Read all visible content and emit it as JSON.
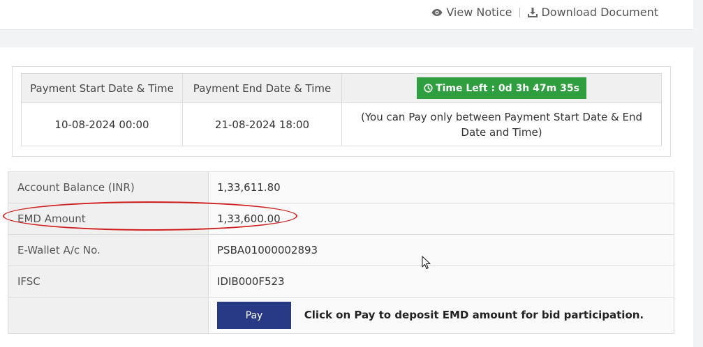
{
  "header": {
    "view_notice": "View Notice",
    "download_document": "Download Document"
  },
  "payment_window": {
    "col_start": "Payment Start Date & Time",
    "col_end": "Payment End Date & Time",
    "time_left": "Time Left : 0d 3h 47m 35s",
    "start_value": "10-08-2024 00:00",
    "end_value": "21-08-2024 18:00",
    "note": "(You can Pay only between Payment Start Date & End Date and Time)"
  },
  "details": {
    "rows": [
      {
        "label": "Account Balance (INR)",
        "value": "1,33,611.80"
      },
      {
        "label": "EMD Amount",
        "value": "1,33,600.00"
      },
      {
        "label": "E-Wallet A/c No.",
        "value": "PSBA01000002893"
      },
      {
        "label": "IFSC",
        "value": "IDIB000F523"
      }
    ],
    "pay_button": "Pay",
    "pay_note": "Click on Pay to deposit EMD amount for bid participation."
  },
  "colors": {
    "time_left_bg": "#2e9e3f",
    "pay_button_bg": "#283a86",
    "annotation": "#d02020"
  }
}
